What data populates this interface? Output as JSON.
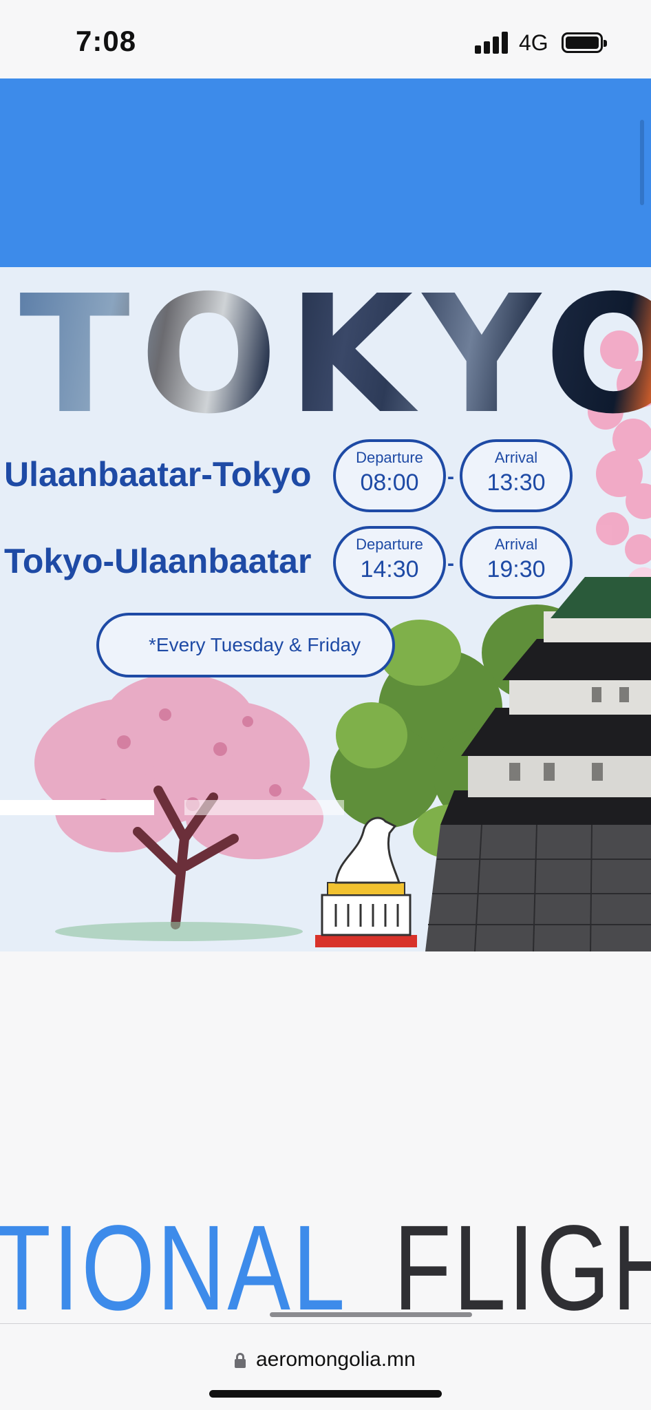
{
  "status_bar": {
    "time": "7:08",
    "network": "4G"
  },
  "banner": {
    "title": "TOKYO",
    "routes": [
      {
        "name": "Ulaanbaatar-Tokyo",
        "departure_label": "Departure",
        "departure_time": "08:00",
        "separator": "-",
        "arrival_label": "Arrival",
        "arrival_time": "13:30"
      },
      {
        "name": "Tokyo-Ulaanbaatar",
        "departure_label": "Departure",
        "departure_time": "14:30",
        "separator": "-",
        "arrival_label": "Arrival",
        "arrival_time": "19:30"
      }
    ],
    "schedule_note": "*Every Tuesday & Friday"
  },
  "section_heading": {
    "part1": "TIONAL",
    "part2": "FLIGH"
  },
  "browser": {
    "url": "aeromongolia.mn"
  },
  "colors": {
    "brand_blue": "#3d8bea",
    "banner_text": "#1e4aa5",
    "banner_bg": "#e6eef8"
  },
  "icons": [
    "signal-icon",
    "battery-icon",
    "lock-icon"
  ]
}
